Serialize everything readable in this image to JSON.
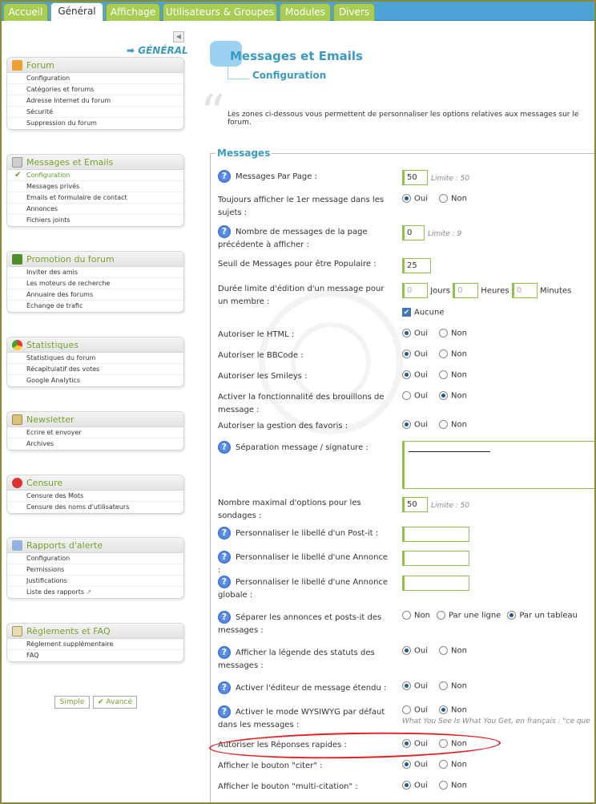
{
  "tabs": [
    {
      "label": "Accueil",
      "active": false
    },
    {
      "label": "Général",
      "active": true
    },
    {
      "label": "Affichage",
      "active": false
    },
    {
      "label": "Utilisateurs & Groupes",
      "active": false
    },
    {
      "label": "Modules",
      "active": false
    },
    {
      "label": "Divers",
      "active": false
    }
  ],
  "sidebar": {
    "title": "GÉNÉRAL",
    "collapse_icon": "triangle-left-icon",
    "sections": [
      {
        "title": "Forum",
        "icon": "wrench-icon",
        "items": [
          "Configuration",
          "Catégories et forums",
          "Adresse Internet du forum",
          "Sécurité",
          "Suppression du forum"
        ]
      },
      {
        "title": "Messages et Emails",
        "icon": "document-icon",
        "items": [
          "Configuration",
          "Messages privés",
          "Emails et formulaire de contact",
          "Annonces",
          "Fichiers joints"
        ]
      },
      {
        "title": "Promotion du forum",
        "icon": "flag-icon",
        "items": [
          "Inviter des amis",
          "Les moteurs de recherche",
          "Annuaire des forums",
          "Échange de trafic"
        ]
      },
      {
        "title": "Statistiques",
        "icon": "pie-chart-icon",
        "items": [
          "Statistiques du forum",
          "Récapitulatif des votes",
          "Google Analytics"
        ]
      },
      {
        "title": "Newsletter",
        "icon": "envelope-icon",
        "items": [
          "Ecrire et envoyer",
          "Archives"
        ]
      },
      {
        "title": "Censure",
        "icon": "no-entry-icon",
        "items": [
          "Censure des Mots",
          "Censure des noms d'utilisateurs"
        ]
      },
      {
        "title": "Rapports d'alerte",
        "icon": "megaphone-icon",
        "items": [
          "Configuration",
          "Permissions",
          "Justifications",
          "Liste des rapports"
        ]
      },
      {
        "title": "Règlements et FAQ",
        "icon": "scroll-icon",
        "items": [
          "Règlement supplémentaire",
          "FAQ"
        ]
      }
    ],
    "buttons": {
      "simple": "Simple",
      "advanced": "Avancé"
    }
  },
  "main": {
    "title": "Messages et Emails",
    "subtitle": "Configuration",
    "intro": "Les zones ci-dessous vous permettent de personnaliser les options relatives aux messages sur le forum.",
    "legend": "Messages"
  },
  "settings": {
    "messages_per_page": {
      "label": "Messages Par Page :",
      "value": "50",
      "limit": "Limite : 50"
    },
    "show_first_message": {
      "label": "Toujours afficher le 1er message dans les sujets :",
      "yes": "Oui",
      "no": "Non",
      "selected": "yes"
    },
    "prev_page_messages": {
      "label": "Nombre de messages de la page précédente à afficher :",
      "value": "0",
      "limit": "Limite : 9"
    },
    "popular_threshold": {
      "label": "Seuil de Messages pour être Populaire :",
      "value": "25"
    },
    "edit_limit": {
      "label": "Durée limite d'édition d'un message pour un membre :",
      "days": "0",
      "days_label": "Jours",
      "hours": "0",
      "hours_label": "Heures",
      "minutes": "0",
      "minutes_label": "Minutes",
      "none_label": "Aucune",
      "none_checked": true
    },
    "allow_html": {
      "label": "Autoriser le HTML :",
      "yes": "Oui",
      "no": "Non",
      "selected": "yes"
    },
    "allow_bbcode": {
      "label": "Autoriser le BBCode :",
      "yes": "Oui",
      "no": "Non",
      "selected": "yes"
    },
    "allow_smileys": {
      "label": "Autoriser les Smileys :",
      "yes": "Oui",
      "no": "Non",
      "selected": "yes"
    },
    "drafts": {
      "label": "Activer la fonctionnalité des brouillons de message :",
      "yes": "Oui",
      "no": "Non",
      "selected": "no"
    },
    "favorites": {
      "label": "Autoriser la gestion des favoris :",
      "yes": "Oui",
      "no": "Non",
      "selected": "yes"
    },
    "signature_sep": {
      "label": "Séparation message / signature :"
    },
    "poll_options": {
      "label": "Nombre maximal d'options pour les sondages :",
      "value": "50",
      "limit": "Limite : 50"
    },
    "postit_label": {
      "label": "Personnaliser le libellé d'un Post-it :",
      "value": ""
    },
    "announce_label": {
      "label": "Personnaliser le libellé d'une Annonce :",
      "value": ""
    },
    "global_announce_label": {
      "label": "Personnaliser le libellé d'une Annonce globale :",
      "value": ""
    },
    "separate_announces": {
      "label": "Séparer les annonces et posts-it des messages :",
      "no": "Non",
      "line": "Par une ligne",
      "table": "Par un tableau",
      "selected": "table"
    },
    "status_legend": {
      "label": "Afficher la légende des statuts des messages :",
      "yes": "Oui",
      "no": "Non",
      "selected": "yes"
    },
    "extended_editor": {
      "label": "Activer l'éditeur de message étendu :",
      "yes": "Oui",
      "no": "Non",
      "selected": "yes"
    },
    "wysiwyg": {
      "label": "Activer le mode WYSIWYG par défaut dans les messages :",
      "yes": "Oui",
      "no": "Non",
      "selected": "no",
      "note": "What You See Is What You Get, en français : \"ce que"
    },
    "quick_reply": {
      "label": "Autoriser les Réponses rapides :",
      "yes": "Oui",
      "no": "Non",
      "selected": "yes"
    },
    "quote_button": {
      "label": "Afficher le bouton \"citer\" :",
      "yes": "Oui",
      "no": "Non",
      "selected": "yes"
    },
    "multiquote_button": {
      "label": "Afficher le bouton \"multi-citation\" :",
      "yes": "Oui",
      "no": "Non",
      "selected": "yes"
    }
  },
  "colors": {
    "accent_green": "#8fc24a",
    "accent_blue": "#3b9ac2",
    "annotation_red": "#e32020"
  }
}
